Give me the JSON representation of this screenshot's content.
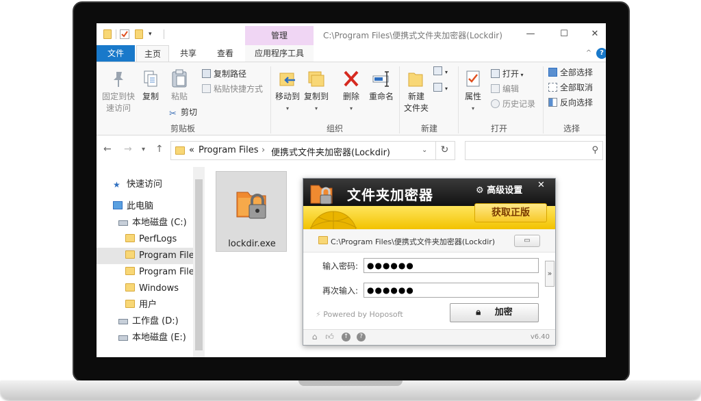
{
  "explorer": {
    "title_path": "C:\\Program Files\\便携式文件夹加密器(Lockdir)",
    "contextual_tab": "管理",
    "tabs": [
      "文件",
      "主页",
      "共享",
      "查看",
      "应用程序工具"
    ],
    "ribbon": {
      "clipboard": {
        "pin_line1": "固定到快",
        "pin_line2": "速访问",
        "copy": "复制",
        "paste": "粘贴",
        "copy_path": "复制路径",
        "paste_shortcut": "粘贴快捷方式",
        "cut": "剪切",
        "group": "剪贴板"
      },
      "organize": {
        "move_to": "移动到",
        "copy_to": "复制到",
        "delete": "删除",
        "rename": "重命名",
        "group": "组织"
      },
      "new": {
        "new_folder_line1": "新建",
        "new_folder_line2": "文件夹",
        "group": "新建"
      },
      "open": {
        "properties": "属性",
        "open": "打开",
        "edit": "编辑",
        "history": "历史记录",
        "group": "打开"
      },
      "select": {
        "select_all": "全部选择",
        "select_none": "全部取消",
        "invert": "反向选择",
        "group": "选择"
      }
    },
    "address": {
      "chevrons": "«",
      "part1": "Program Files",
      "sep": "›",
      "part2": "便携式文件夹加密器(Lockdir)"
    },
    "nav": {
      "quick_access": "快速访问",
      "this_pc": "此电脑",
      "drive_c": "本地磁盘 (C:)",
      "perflogs": "PerfLogs",
      "program_files_1": "Program Files",
      "program_files_2": "Program Files",
      "windows": "Windows",
      "users": "用户",
      "drive_d": "工作盘 (D:)",
      "drive_e": "本地磁盘 (E:)"
    },
    "file": {
      "name": "lockdir.exe"
    }
  },
  "app": {
    "title": "文件夹加密器",
    "settings": "高级设置",
    "close": "✕",
    "get_genuine": "获取正版",
    "path": "C:\\Program Files\\便携式文件夹加密器(Lockdir)",
    "password_label": "输入密码:",
    "password_value": "●●●●●●",
    "confirm_label": "再次输入:",
    "confirm_value": "●●●●●●",
    "expand": "»",
    "powered_by": "Powered by Hoposoft",
    "encrypt_button": "加密",
    "version": "v6.40"
  },
  "colors": {
    "file_tab": "#1979ca",
    "contextual_tab": "#f0d6f4",
    "app_banner": "#f2c200"
  }
}
